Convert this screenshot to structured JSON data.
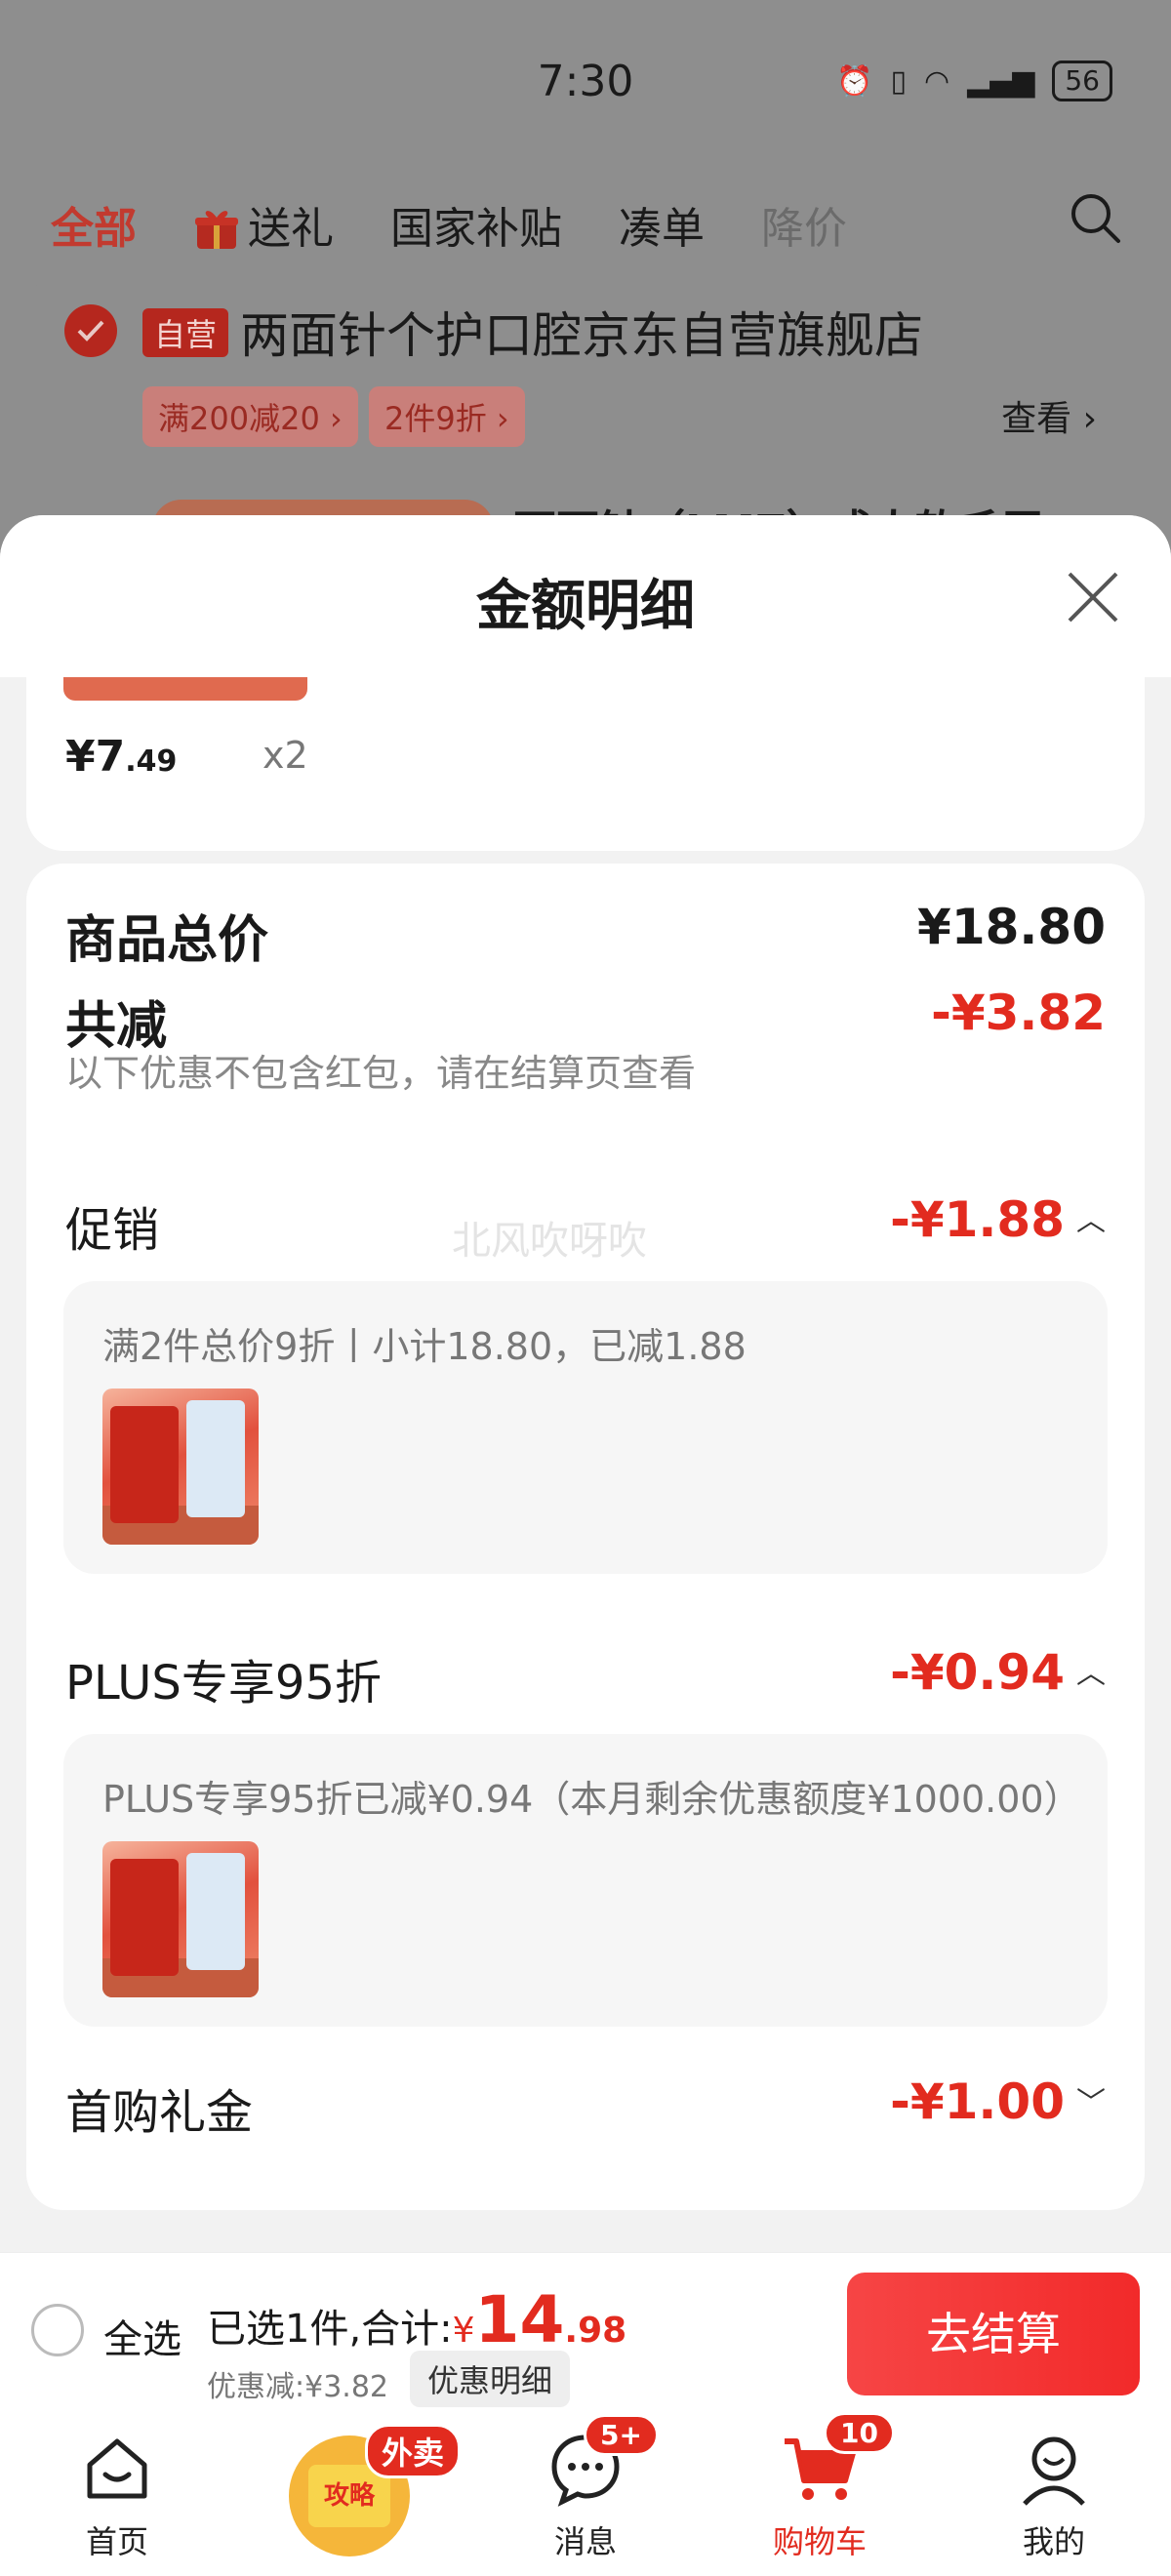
{
  "status_bar": {
    "time": "7:30",
    "battery": "56"
  },
  "top_tabs": [
    {
      "label": "全部"
    },
    {
      "label": "送礼"
    },
    {
      "label": "国家补贴"
    },
    {
      "label": "凑单"
    },
    {
      "label": "降价"
    }
  ],
  "store": {
    "badge": "自营",
    "name": "两面针个护口腔京东自营旗舰店",
    "coupons": [
      "满200减20 ›",
      "2件9折 ›"
    ],
    "view_label": "查看 ›",
    "product_title_peek": "两面针（LMZ）成人软毛牙"
  },
  "sheet": {
    "title": "金额明细",
    "item": {
      "price_int": "¥7",
      "price_dec": ".49",
      "qty": "x2"
    },
    "total_label": "商品总价",
    "total_value": "¥18.80",
    "reduce_label": "共减",
    "reduce_value": "-¥3.82",
    "reduce_hint": "以下优惠不包含红包，请在结算页查看",
    "watermark": "北风吹呀吹",
    "promo": {
      "label": "促销",
      "value": "-¥1.88",
      "detail": "满2件总价9折丨小计18.80，已减1.88"
    },
    "plus": {
      "label": "PLUS专享95折",
      "value": "-¥0.94",
      "detail": "PLUS专享95折已减¥0.94（本月剩余优惠额度¥1000.00）"
    },
    "first_gift": {
      "label": "首购礼金",
      "value": "-¥1.00"
    }
  },
  "checkout": {
    "select_all": "全选",
    "selected_text": "已选1件,合计:",
    "currency": "¥",
    "total_int": "14",
    "total_dec": ".98",
    "discount_text": "优惠减:¥3.82",
    "detail_button": "优惠明细",
    "pay_button": "去结算"
  },
  "bottom_nav": {
    "home": "首页",
    "gonglve_label": "攻略",
    "gonglve_badge": "外卖",
    "messages": "消息",
    "messages_badge": "5+",
    "cart": "购物车",
    "cart_badge": "10",
    "mine": "我的"
  },
  "colors": {
    "accent_red": "#e22b1f",
    "sheet_background": "#f2f2f2",
    "overlay": "#8e8e8e"
  }
}
